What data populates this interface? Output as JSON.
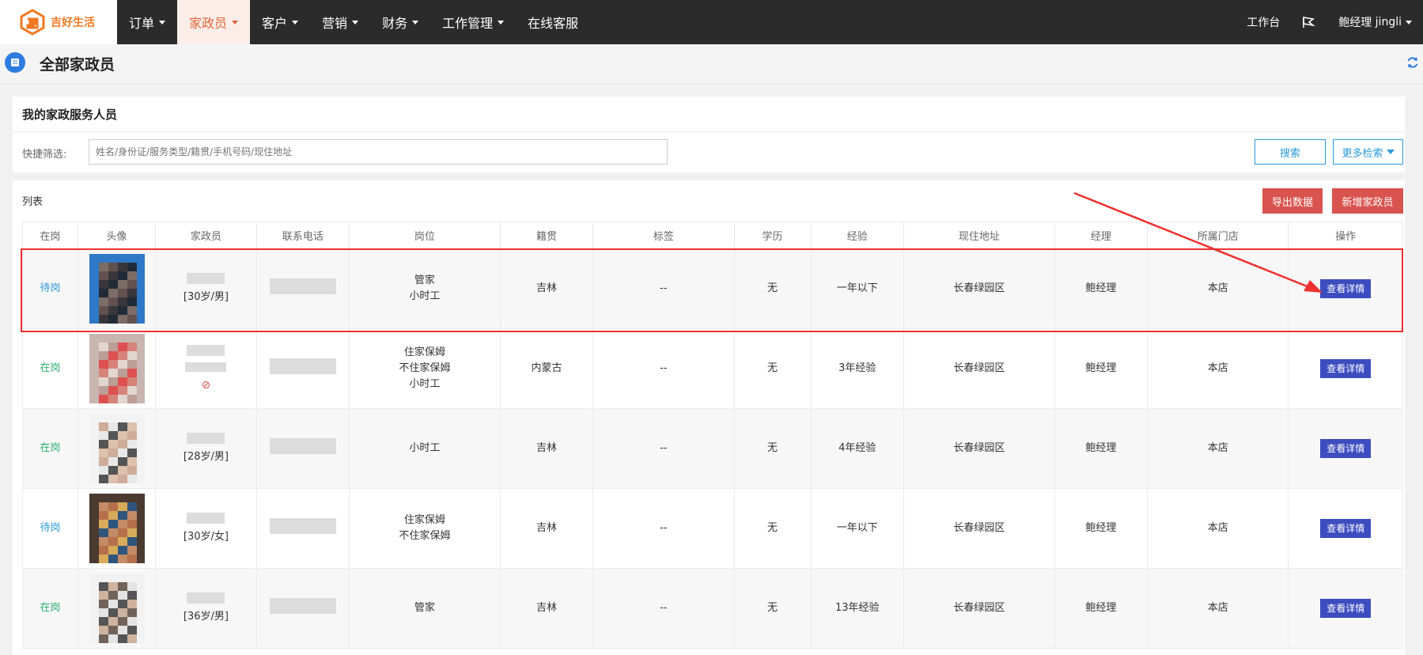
{
  "brand": {
    "name": "吉好生活",
    "color": "#f07820"
  },
  "nav": {
    "items": [
      {
        "label": "订单",
        "caret": true,
        "active": false
      },
      {
        "label": "家政员",
        "caret": true,
        "active": true
      },
      {
        "label": "客户",
        "caret": true,
        "active": false
      },
      {
        "label": "营销",
        "caret": true,
        "active": false
      },
      {
        "label": "财务",
        "caret": true,
        "active": false
      },
      {
        "label": "工作管理",
        "caret": true,
        "active": false
      },
      {
        "label": "在线客服",
        "caret": false,
        "active": false
      }
    ],
    "workbench": "工作台",
    "user_role": "鲍经理",
    "user_name": "jingli"
  },
  "page": {
    "title": "全部家政员"
  },
  "filter": {
    "title": "我的家政服务人员",
    "label": "快捷筛选:",
    "placeholder": "姓名/身份证/服务类型/籍贯/手机号码/现住地址",
    "search_label": "搜索",
    "more_label": "更多检索"
  },
  "list": {
    "title": "列表",
    "export_label": "导出数据",
    "add_label": "新增家政员",
    "columns": [
      "在岗",
      "头像",
      "家政员",
      "联系电话",
      "岗位",
      "籍贯",
      "标签",
      "学历",
      "经验",
      "现住地址",
      "经理",
      "所属门店",
      "操作"
    ],
    "rows": [
      {
        "status": "待岗",
        "status_type": "wait",
        "info": "[30岁/男]",
        "roles": [
          "管家",
          "小时工"
        ],
        "origin": "吉林",
        "tags": "--",
        "education": "无",
        "experience": "一年以下",
        "address": "长春绿园区",
        "manager": "鲍经理",
        "store": "本店",
        "action": "查看详情",
        "forbid": ""
      },
      {
        "status": "在岗",
        "status_type": "on",
        "info": "",
        "roles": [
          "住家保姆",
          "不住家保姆",
          "小时工"
        ],
        "origin": "内蒙古",
        "tags": "--",
        "education": "无",
        "experience": "3年经验",
        "address": "长春绿园区",
        "manager": "鲍经理",
        "store": "本店",
        "action": "查看详情",
        "forbid": "⊘"
      },
      {
        "status": "在岗",
        "status_type": "on",
        "info": "[28岁/男]",
        "roles": [
          "小时工"
        ],
        "origin": "吉林",
        "tags": "--",
        "education": "无",
        "experience": "4年经验",
        "address": "长春绿园区",
        "manager": "鲍经理",
        "store": "本店",
        "action": "查看详情",
        "forbid": ""
      },
      {
        "status": "待岗",
        "status_type": "wait",
        "info": "[30岁/女]",
        "roles": [
          "住家保姆",
          "不住家保姆"
        ],
        "origin": "吉林",
        "tags": "--",
        "education": "无",
        "experience": "一年以下",
        "address": "长春绿园区",
        "manager": "鲍经理",
        "store": "本店",
        "action": "查看详情",
        "forbid": ""
      },
      {
        "status": "在岗",
        "status_type": "on",
        "info": "[36岁/男]",
        "roles": [
          "管家"
        ],
        "origin": "吉林",
        "tags": "--",
        "education": "无",
        "experience": "13年经验",
        "address": "长春绿园区",
        "manager": "鲍经理",
        "store": "本店",
        "action": "查看详情",
        "forbid": ""
      }
    ]
  }
}
